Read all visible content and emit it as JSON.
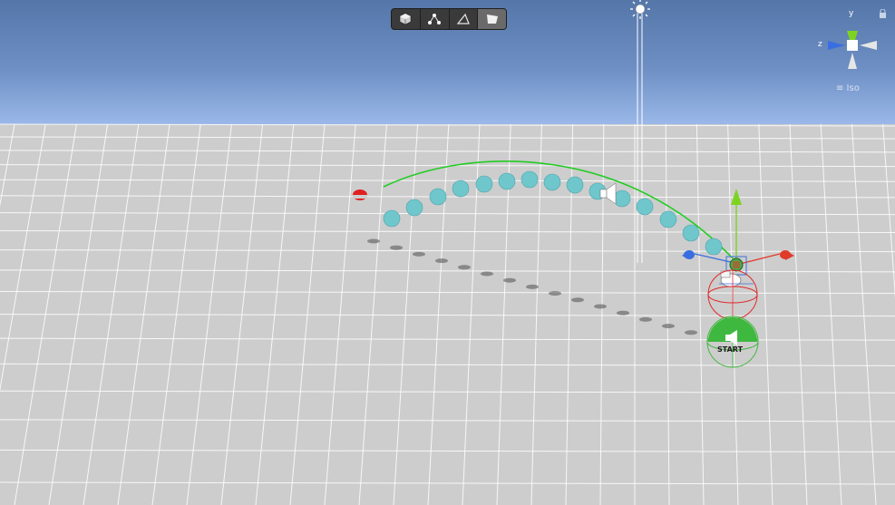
{
  "scene_view": {
    "toolbar": {
      "tools": [
        {
          "name": "shaded-tool",
          "icon": "cube-icon"
        },
        {
          "name": "wireframe-tool",
          "icon": "nodes-icon"
        },
        {
          "name": "mesh-tool",
          "icon": "triangle-icon"
        },
        {
          "name": "plane-tool",
          "icon": "plane-icon"
        }
      ]
    },
    "orientation_gizmo": {
      "y_label": "y",
      "z_label": "z",
      "projection_label": "≡ Iso"
    },
    "start_marker": {
      "label": "START"
    },
    "colors": {
      "sky_top": "#5576a8",
      "sky_bottom": "#9ab8e8",
      "ground": "#cdcdcd",
      "trajectory": "#22cc22",
      "ball": "#6fc7cc",
      "x_axis": "#e03a2a",
      "y_axis": "#7ed321",
      "z_axis": "#3a6ee0"
    }
  }
}
